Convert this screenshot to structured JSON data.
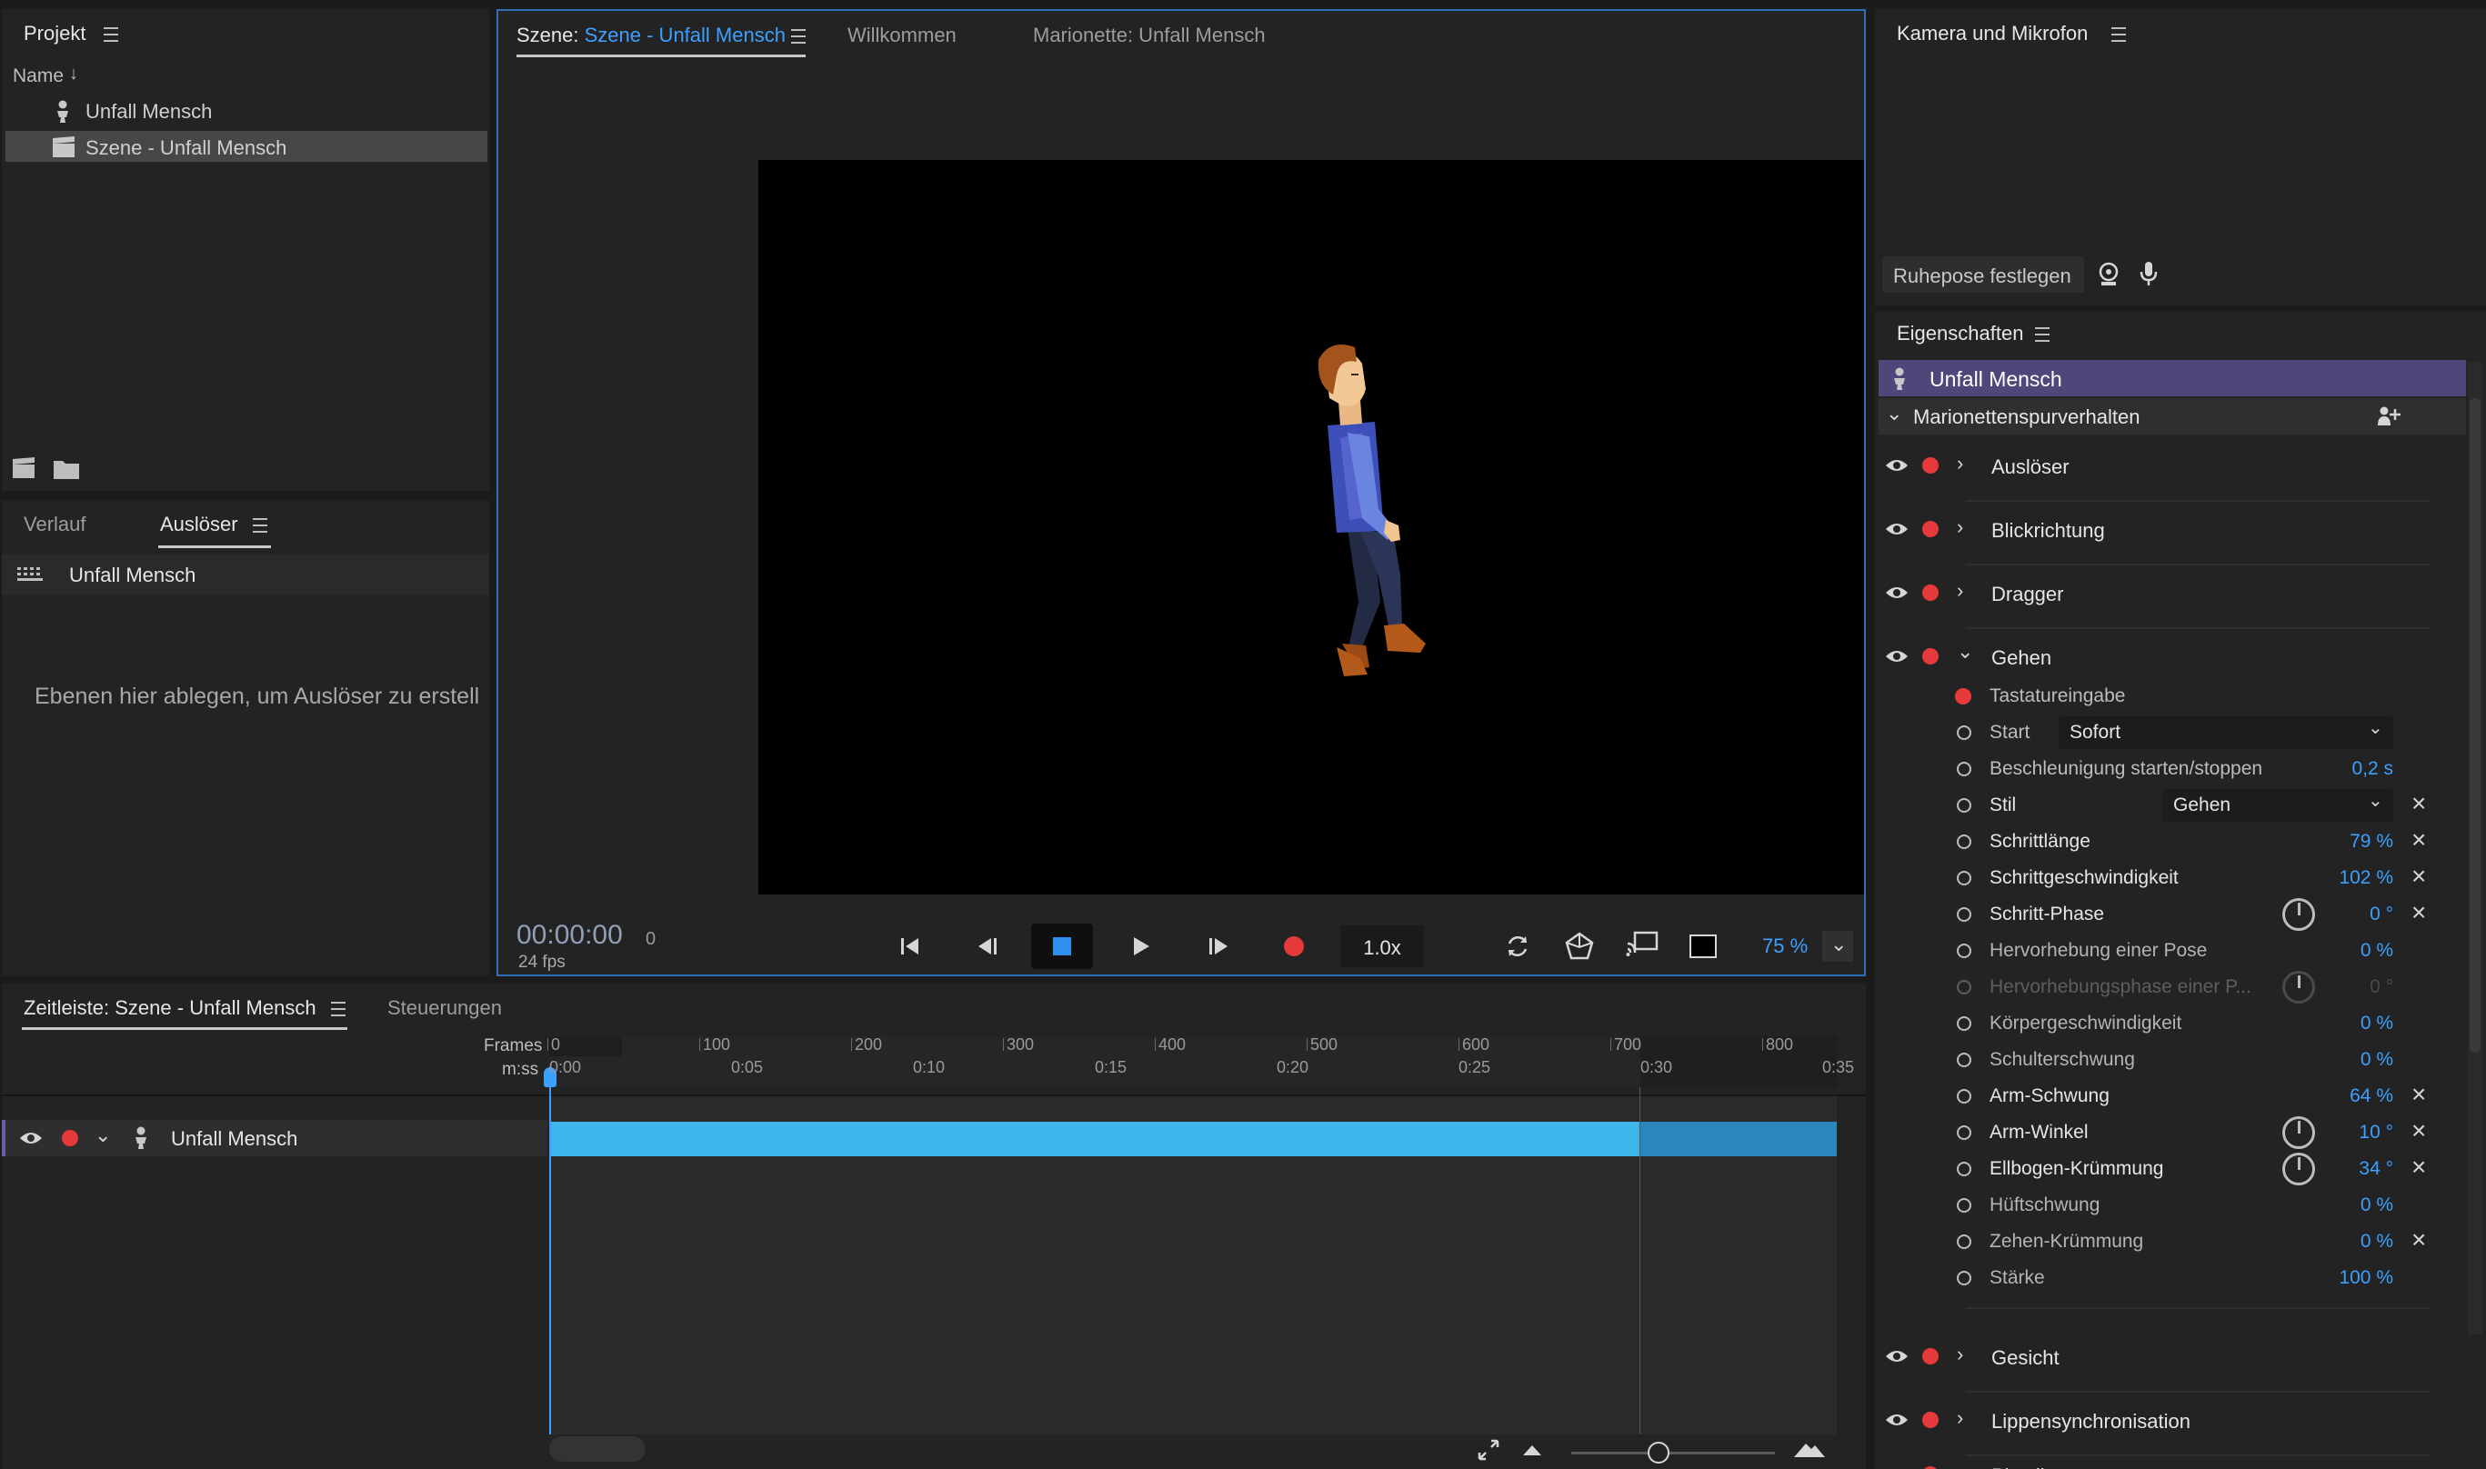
{
  "project_panel": {
    "title": "Projekt",
    "name_column": "Name",
    "items": [
      "Unfall Mensch",
      "Szene - Unfall Mensch"
    ]
  },
  "triggers_panel": {
    "tabs": [
      "Verlauf",
      "Auslöser"
    ],
    "puppet_name": "Unfall Mensch",
    "drop_hint": "Ebenen hier ablegen, um Auslöser zu erstell"
  },
  "scene_panel": {
    "tabs": {
      "scene_prefix": "Szene:",
      "scene_name": "Szene - Unfall Mensch",
      "welcome": "Willkommen",
      "puppet": "Marionette: Unfall Mensch"
    },
    "timecode": "00:00:00",
    "frame": "0",
    "fps": "24 fps",
    "speed": "1.0x",
    "zoom": "75 %"
  },
  "timeline_panel": {
    "tabs": [
      "Zeitleiste: Szene - Unfall Mensch",
      "Steuerungen"
    ],
    "frames_label": "Frames",
    "time_label": "m:ss",
    "frame_ticks": [
      "0",
      "100",
      "200",
      "300",
      "400",
      "500",
      "600",
      "700",
      "800"
    ],
    "time_ticks": [
      "0:00",
      "0:05",
      "0:10",
      "0:15",
      "0:20",
      "0:25",
      "0:30",
      "0:35"
    ],
    "track_name": "Unfall Mensch"
  },
  "camera_panel": {
    "title": "Kamera und Mikrofon",
    "rest_pose_button": "Ruhepose festlegen"
  },
  "properties_panel": {
    "title": "Eigenschaften",
    "puppet_name": "Unfall Mensch",
    "section": "Marionettenspurverhalten",
    "behaviors_top": [
      "Auslöser",
      "Blickrichtung",
      "Dragger",
      "Gehen"
    ],
    "gehen": {
      "keyboard": "Tastatureingabe",
      "start_label": "Start",
      "start_value": "Sofort",
      "accel_label": "Beschleunigung starten/stoppen",
      "accel_value": "0,2 s",
      "style_label": "Stil",
      "style_value": "Gehen",
      "params": [
        {
          "label": "Schrittlänge",
          "value": "79 %"
        },
        {
          "label": "Schrittgeschwindigkeit",
          "value": "102 %"
        },
        {
          "label": "Schritt-Phase",
          "value": "0 °"
        },
        {
          "label": "Hervorhebung einer Pose",
          "value": "0 %"
        },
        {
          "label": "Hervorhebungsphase einer P...",
          "value": "0 °"
        },
        {
          "label": "Körpergeschwindigkeit",
          "value": "0 %"
        },
        {
          "label": "Schulterschwung",
          "value": "0 %"
        },
        {
          "label": "Arm-Schwung",
          "value": "64 %"
        },
        {
          "label": "Arm-Winkel",
          "value": "10 °"
        },
        {
          "label": "Ellbogen-Krümmung",
          "value": "34 °"
        },
        {
          "label": "Hüftschwung",
          "value": "0 %"
        },
        {
          "label": "Zehen-Krümmung",
          "value": "0 %"
        },
        {
          "label": "Stärke",
          "value": "100 %"
        }
      ]
    },
    "behaviors_bottom": [
      "Gesicht",
      "Lippensynchronisation",
      "Physik"
    ]
  }
}
